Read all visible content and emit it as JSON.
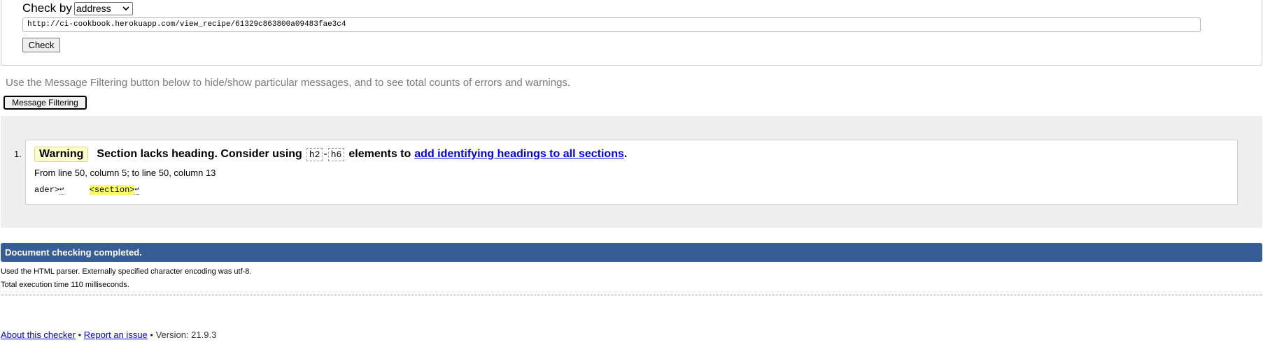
{
  "form": {
    "check_by_label": "Check by",
    "check_by_selected": "address",
    "url_value": "http://ci-cookbook.herokuapp.com/view_recipe/61329c863800a09483fae3c4",
    "check_button": "Check"
  },
  "instructions": "Use the Message Filtering button below to hide/show particular messages, and to see total counts of errors and warnings.",
  "filter_button": "Message Filtering",
  "messages": [
    {
      "number": "1.",
      "type": "Warning",
      "text_before": "Section lacks heading. Consider using",
      "code_start": "h2",
      "dash": "-",
      "code_end": "h6",
      "text_middle": "elements to",
      "link_text": "add identifying headings to all sections",
      "text_after": ".",
      "location": "From line 50, column 5; to line 50, column 13",
      "extract_before": "ader>",
      "extract_lf1": "↩",
      "extract_spaces": "     ",
      "extract_highlight": "<section>",
      "extract_lf2": "↩"
    }
  ],
  "status": {
    "completed": "Document checking completed.",
    "parser_info": "Used the HTML parser. Externally specified character encoding was utf-8.",
    "exec_time": "Total execution time 110 milliseconds."
  },
  "footer": {
    "about_link": "About this checker",
    "sep1": " • ",
    "report_link": "Report an issue",
    "version": " • Version: 21.9.3"
  },
  "colors": {
    "status_bar": "#365d95",
    "warning_badge": "#ffffcc",
    "highlight": "#ffff66",
    "link": "#0000ee"
  }
}
